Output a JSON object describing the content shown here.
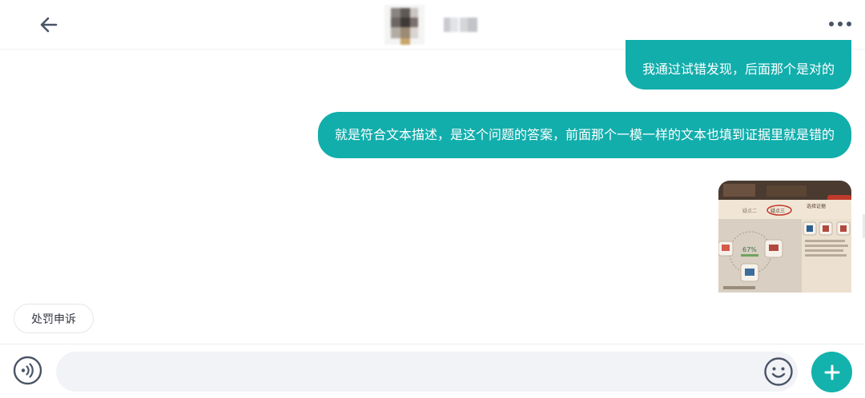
{
  "header": {
    "back_icon": "arrow-left-icon",
    "more_icon": "more-dots-icon"
  },
  "messages": [
    {
      "side": "right",
      "type": "text",
      "text": "我通过试错发现，后面那个是对的"
    },
    {
      "side": "right",
      "type": "text",
      "text": "就是符合文本描述，是这个问题的答案，前面那个一模一样的文本也填到证据里就是错的"
    },
    {
      "side": "right",
      "type": "image",
      "image_text": {
        "tab_2": "疑点二",
        "tab_3": "疑点三",
        "header": "选择证据",
        "percent": "67%"
      }
    }
  ],
  "quick_action": {
    "label": "处罚申诉"
  },
  "input_bar": {
    "placeholder": "",
    "voice_icon": "voice-icon",
    "emoji_icon": "emoji-icon",
    "plus_icon": "plus-icon"
  },
  "colors": {
    "bubble": "#12aeac",
    "accent": "#13b2ad",
    "icon": "#4a5466"
  }
}
